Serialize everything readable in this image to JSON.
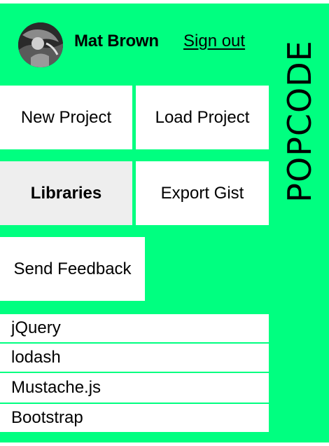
{
  "user": {
    "name": "Mat Brown",
    "sign_out_label": "Sign out"
  },
  "brand": {
    "name": "POPCODE"
  },
  "menu": {
    "new_project": "New Project",
    "load_project": "Load Project",
    "libraries": "Libraries",
    "export_gist": "Export Gist",
    "send_feedback": "Send Feedback"
  },
  "libraries": [
    {
      "label": "jQuery"
    },
    {
      "label": "lodash"
    },
    {
      "label": "Mustache.js"
    },
    {
      "label": "Bootstrap"
    }
  ],
  "colors": {
    "background": "#00ff80",
    "tile": "#ffffff",
    "active_tile": "#eeeeee"
  }
}
